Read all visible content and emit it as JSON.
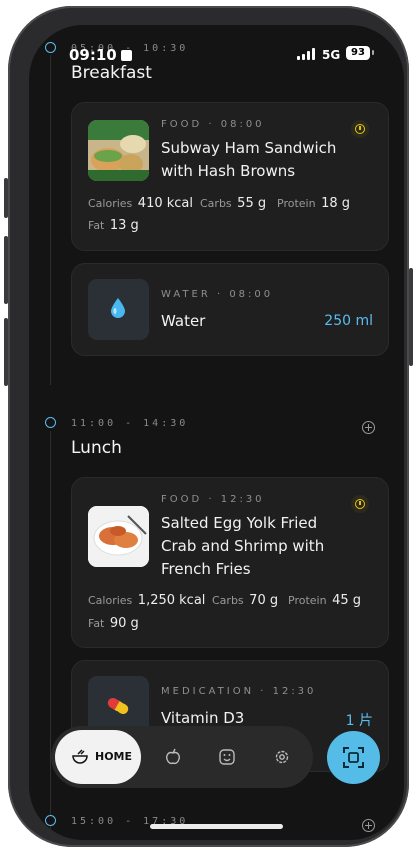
{
  "status": {
    "time": "09:10",
    "network": "5G",
    "battery": "93"
  },
  "sections": [
    {
      "range": "05:00 - 10:30",
      "title": "Breakfast"
    },
    {
      "range": "11:00 - 14:30",
      "title": "Lunch"
    },
    {
      "range": "15:00 - 17:30"
    }
  ],
  "cards": {
    "sandwich": {
      "category": "FOOD · 08:00",
      "title": "Subway Ham Sandwich with Hash Browns",
      "calories_label": "Calories",
      "calories": "410 kcal",
      "carbs_label": "Carbs",
      "carbs": "55 g",
      "protein_label": "Protein",
      "protein": "18 g",
      "fat_label": "Fat",
      "fat": "13 g"
    },
    "water": {
      "category": "WATER · 08:00",
      "title": "Water",
      "amount": "250 ml"
    },
    "crab": {
      "category": "FOOD · 12:30",
      "title": "Salted Egg Yolk Fried Crab and Shrimp with French Fries",
      "calories_label": "Calories",
      "calories": "1,250 kcal",
      "carbs_label": "Carbs",
      "carbs": "70 g",
      "protein_label": "Protein",
      "protein": "45 g",
      "fat_label": "Fat",
      "fat": "90 g"
    },
    "vitamin": {
      "category": "MEDICATION · 12:30",
      "title": "Vitamin D3",
      "amount": "1 片"
    }
  },
  "nav": {
    "home_label": "HOME"
  },
  "colors": {
    "accent": "#5bbcf0",
    "warning": "#e5c318",
    "background": "#141414",
    "card": "#1f1f1f"
  }
}
